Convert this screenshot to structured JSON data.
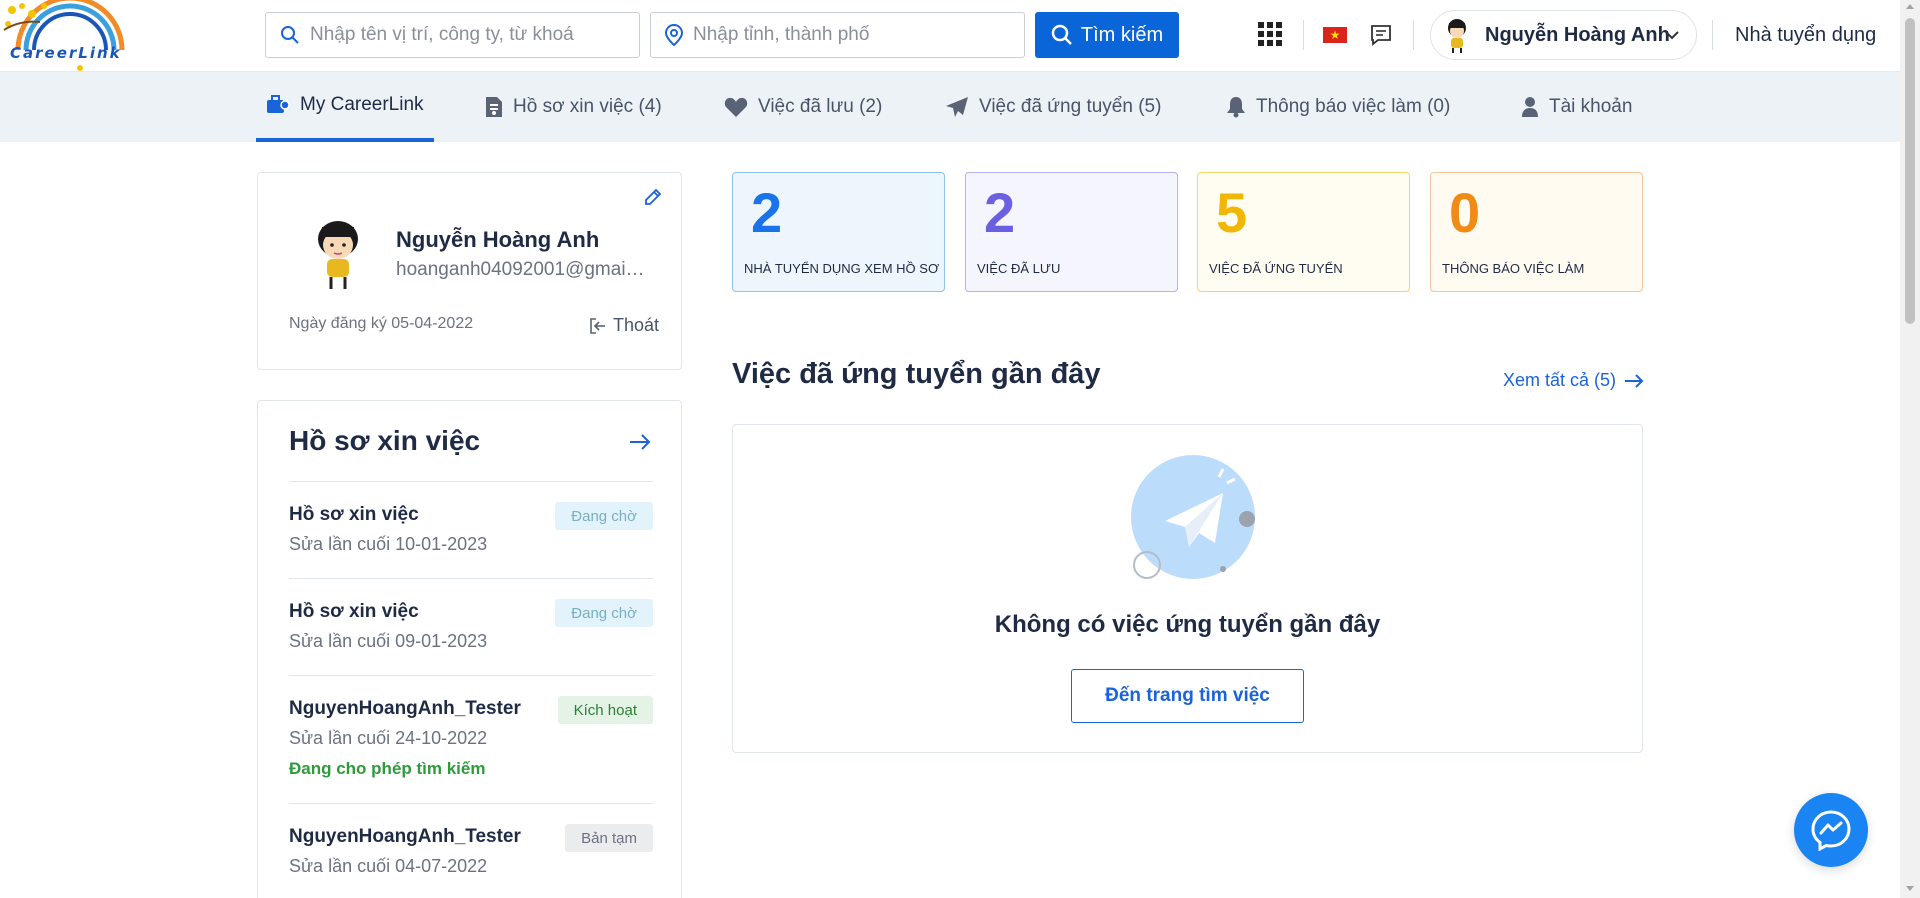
{
  "header": {
    "logo_text": "CareerLink",
    "search_keyword_placeholder": "Nhập tên vị trí, công ty, từ khoá",
    "search_location_placeholder": "Nhập tỉnh, thành phố",
    "search_button": "Tìm kiếm",
    "user_name": "Nguyễn Hoàng Anh",
    "employer_link": "Nhà tuyển dụng",
    "flag": "vietnam-flag"
  },
  "nav": {
    "items": [
      {
        "label": "My CareerLink",
        "icon": "briefcase-user-icon",
        "active": true
      },
      {
        "label": "Hồ sơ xin việc (4)",
        "icon": "document-icon"
      },
      {
        "label": "Việc đã lưu (2)",
        "icon": "heart-icon"
      },
      {
        "label": "Việc đã ứng tuyển (5)",
        "icon": "paper-plane-icon"
      },
      {
        "label": "Thông báo việc làm (0)",
        "icon": "bell-icon"
      },
      {
        "label": "Tài khoản",
        "icon": "user-icon"
      }
    ]
  },
  "profile": {
    "name": "Nguyễn Hoàng Anh",
    "email": "hoanganh04092001@gmail.com",
    "reg_date": "Ngày đăng ký 05-04-2022",
    "logout": "Thoát"
  },
  "resumes": {
    "title": "Hồ sơ xin việc",
    "items": [
      {
        "name": "Hồ sơ xin việc",
        "date": "Sửa lần cuối 10-01-2023",
        "status": "Đang chờ"
      },
      {
        "name": "Hồ sơ xin việc",
        "date": "Sửa lần cuối 09-01-2023",
        "status": "Đang chờ"
      },
      {
        "name": "NguyenHoangAnh_Tester",
        "date": "Sửa lần cuối 24-10-2022",
        "status": "Kích hoạt",
        "note": "Đang cho phép tìm kiếm"
      },
      {
        "name": "NguyenHoangAnh_Tester",
        "date": "Sửa lần cuối 04-07-2022",
        "status": "Bản tạm"
      }
    ]
  },
  "stats": [
    {
      "value": "2",
      "label": "NHÀ TUYỂN DỤNG XEM HỒ SƠ",
      "color": "#1a73e8"
    },
    {
      "value": "2",
      "label": "VIỆC ĐÃ LƯU",
      "color": "#6b61e0"
    },
    {
      "value": "5",
      "label": "VIỆC ĐÃ ỨNG TUYỂN",
      "color": "#f2b705"
    },
    {
      "value": "0",
      "label": "THÔNG BÁO VIỆC LÀM",
      "color": "#f08b16"
    }
  ],
  "recent": {
    "title": "Việc đã ứng tuyển gần đây",
    "see_all": "Xem tất cả (5)",
    "empty_text": "Không có việc ứng tuyển gần đây",
    "goto_button": "Đến trang tìm việc"
  },
  "colors": {
    "primary": "#0a66d8",
    "nav_bg": "#edf2f7",
    "active_green": "#2e9b3b",
    "messenger": "#1a84f3"
  }
}
